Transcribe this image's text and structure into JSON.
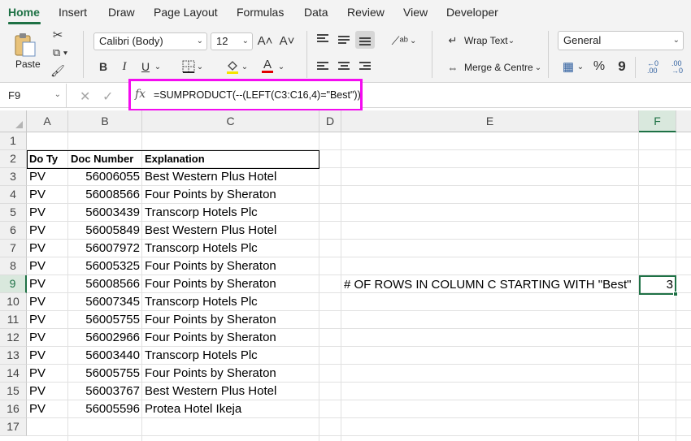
{
  "ribbon_tabs": [
    "Home",
    "Insert",
    "Draw",
    "Page Layout",
    "Formulas",
    "Data",
    "Review",
    "View",
    "Developer"
  ],
  "ribbon": {
    "paste_label": "Paste",
    "font_name": "Calibri (Body)",
    "font_size": "12",
    "grow_font": "A˄",
    "shrink_font": "A˅",
    "bold": "B",
    "italic": "I",
    "underline": "U",
    "font_color_glyph": "A",
    "wrap_text": "Wrap Text",
    "merge_centre": "Merge & Centre",
    "number_format": "General",
    "percent": "%",
    "comma": "9"
  },
  "formula_bar": {
    "name_box": "F9",
    "formula": "=SUMPRODUCT(--(LEFT(C3:C16,4)=\"Best\"))",
    "fx": "fx"
  },
  "columns": [
    "A",
    "B",
    "C",
    "D",
    "E",
    "F"
  ],
  "rows": [
    "1",
    "2",
    "3",
    "4",
    "5",
    "6",
    "7",
    "8",
    "9",
    "10",
    "11",
    "12",
    "13",
    "14",
    "15",
    "16",
    "17"
  ],
  "table": {
    "headers": [
      "Do Ty",
      "Doc Number",
      "Explanation"
    ],
    "data": [
      [
        "PV",
        "56006055",
        "Best Western Plus Hotel"
      ],
      [
        "PV",
        "56008566",
        "Four Points by Sheraton"
      ],
      [
        "PV",
        "56003439",
        "Transcorp Hotels Plc"
      ],
      [
        "PV",
        "56005849",
        "Best Western Plus Hotel"
      ],
      [
        "PV",
        "56007972",
        "Transcorp Hotels Plc"
      ],
      [
        "PV",
        "56005325",
        "Four Points by Sheraton"
      ],
      [
        "PV",
        "56008566",
        "Four Points by Sheraton"
      ],
      [
        "PV",
        "56007345",
        "Transcorp Hotels Plc"
      ],
      [
        "PV",
        "56005755",
        "Four Points by Sheraton"
      ],
      [
        "PV",
        "56002966",
        "Four Points by Sheraton"
      ],
      [
        "PV",
        "56003440",
        "Transcorp Hotels Plc"
      ],
      [
        "PV",
        "56005755",
        "Four Points by Sheraton"
      ],
      [
        "PV",
        "56003767",
        "Best Western Plus Hotel"
      ],
      [
        "PV",
        "56005596",
        "Protea Hotel Ikeja"
      ]
    ]
  },
  "result": {
    "label": "# OF ROWS IN COLUMN C STARTING WITH \"Best\"",
    "value": "3"
  },
  "colors": {
    "accent": "#1e7145",
    "highlight": "#f40cf0"
  }
}
